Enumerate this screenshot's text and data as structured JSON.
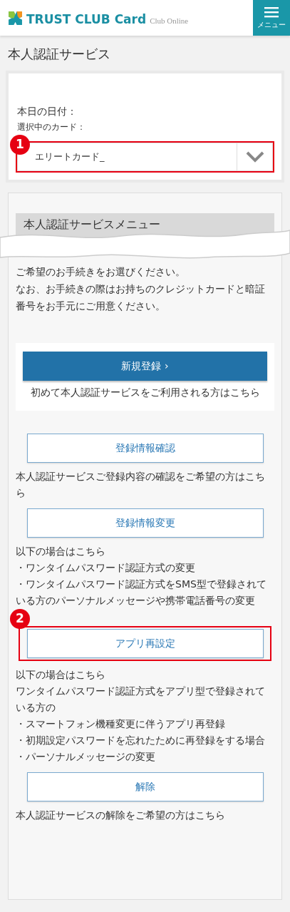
{
  "header": {
    "logo_text": "TRUST CLUB Card",
    "logo_sub": "Club Online",
    "menu_label": "メニュー"
  },
  "page_title": "本人認証サービス",
  "card_panel": {
    "date_label": "本日の日付：",
    "card_label": "選択中のカード：",
    "card_select": {
      "value": "エリートカード_",
      "callout": "1"
    }
  },
  "menu_panel": {
    "heading": "本人認証サービスメニュー",
    "intro": [
      "ご希望のお手続きをお選びください。",
      "なお、お手続きの際はお持ちのクレジットカードと暗証番号をお手元にご用意ください。"
    ],
    "items": [
      {
        "kind": "primary",
        "button": "新規登録 ›",
        "description": [
          "初めて本人認証サービスをご利用される方はこちら"
        ]
      },
      {
        "kind": "outline",
        "button": "登録情報確認",
        "description": [
          "本人認証サービスご登録内容の確認をご希望の方はこちら"
        ]
      },
      {
        "kind": "outline",
        "button": "登録情報変更",
        "description": [
          "以下の場合はこちら",
          "・ワンタイムパスワード認証方式の変更",
          "・ワンタイムパスワード認証方式をSMS型で登録されている方のパーソナルメッセージや携帯電話番号の変更"
        ]
      },
      {
        "kind": "outline",
        "button": "アプリ再設定",
        "callout": "2",
        "description": [
          "以下の場合はこちら",
          "ワンタイムパスワード認証方式をアプリ型で登録されている方の",
          "・スマートフォン機種変更に伴うアプリ再登録",
          "・初期設定パスワードを忘れたために再登録をする場合",
          "・パーソナルメッセージの変更"
        ]
      },
      {
        "kind": "outline",
        "button": "解除",
        "description": [
          "本人認証サービスの解除をご希望の方はこちら"
        ]
      }
    ]
  }
}
